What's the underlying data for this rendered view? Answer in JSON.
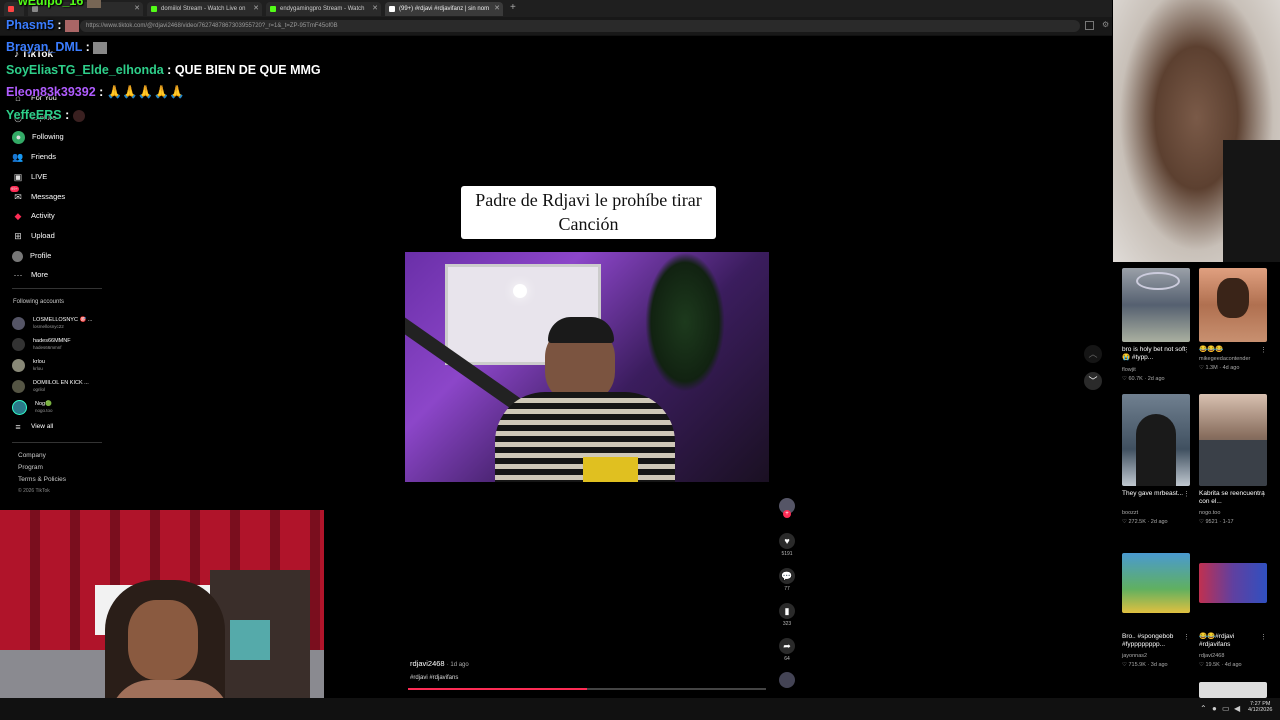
{
  "browser": {
    "tabs": [
      {
        "label": "",
        "color": "#ff4444"
      },
      {
        "label": "",
        "color": "#888888"
      },
      {
        "label": "domiilol Stream - Watch Live on",
        "color": "#53fc18"
      },
      {
        "label": "endygamingpro Stream - Watch",
        "color": "#53fc18"
      },
      {
        "label": "(99+) #rdjavi #rdjavifanz | sin nom",
        "color": "#ffffff"
      }
    ],
    "url": "https://www.tiktok.com/@rdjavi2468/video/7627487867303955720?_r=1&_t=ZP-95TmF45of0B"
  },
  "tiktok": {
    "logo": "TikTok",
    "nav": [
      {
        "label": "For You",
        "icon": "home-icon"
      },
      {
        "label": "Explore",
        "icon": "compass-icon"
      },
      {
        "label": "Following",
        "icon": "following-icon"
      },
      {
        "label": "Friends",
        "icon": "friends-icon"
      },
      {
        "label": "LIVE",
        "icon": "live-icon"
      },
      {
        "label": "Messages",
        "icon": "messages-icon",
        "badge": "99+"
      },
      {
        "label": "Activity",
        "icon": "activity-icon"
      },
      {
        "label": "Upload",
        "icon": "upload-icon"
      },
      {
        "label": "Profile",
        "icon": "profile-icon"
      },
      {
        "label": "More",
        "icon": "more-icon"
      }
    ],
    "following_header": "Following accounts",
    "following": [
      {
        "name": "LOSMELLOSNYC 🎯 ...",
        "handle": "losmellosnyc22"
      },
      {
        "name": "hades66MMNF",
        "handle": "hades66mmnf"
      },
      {
        "name": "krlou",
        "handle": "krlou"
      },
      {
        "name": "DOMIILOL EN KICK ...",
        "handle": "ogrilol"
      },
      {
        "name": "Nog🟢",
        "handle": "nogo.too"
      }
    ],
    "view_all": "View all",
    "footer": [
      "Company",
      "Program",
      "Terms & Policies"
    ],
    "copyright": "© 2026 TikTok"
  },
  "chat": [
    {
      "user": "wEuIpo_16",
      "message": "",
      "color": "#53fc18"
    },
    {
      "user": "Phasm5",
      "message": "",
      "color": "#3b7dff"
    },
    {
      "user": "Brayan_DML",
      "message": "",
      "color": "#3b7dff"
    },
    {
      "user": "SoyEliasTG_Elde_elhonda",
      "message": "QUE BIEN DE QUE MMG",
      "color": "#2ecf8a"
    },
    {
      "user": "Eleon83k39392",
      "message": "🙏🙏🙏🙏🙏",
      "color": "#b05cff"
    },
    {
      "user": "YeffeERS",
      "message": "",
      "color": "#2ecf8a"
    }
  ],
  "video": {
    "caption": "Padre de Rdjavi le prohíbe tirar Canción",
    "author": "rdjavi2468",
    "age": "· 1d ago",
    "hashtags": "#rdjavi #rdjavifans",
    "progress": 0.5,
    "likes": "5191",
    "comments": "77",
    "saves": "323",
    "shares": "64"
  },
  "recommended": [
    {
      "title": "bro is holy bet not soft😭 #typp...",
      "author": "flowjit",
      "views": "60.7K",
      "age": "2d ago"
    },
    {
      "title": "😂😂😂",
      "author": "mikegeedacontender",
      "views": "1.3M",
      "age": "4d ago"
    },
    {
      "title": "They gave mrbeast...",
      "author": "boozzt",
      "views": "272.5K",
      "age": "2d ago"
    },
    {
      "title": "Kabrita se reencuentra con el...",
      "author": "nogo.too",
      "views": "9521",
      "age": "1-17"
    },
    {
      "title": "Bro.. #spongebob #fypppppppp...",
      "author": "jayonnas2",
      "views": "715.9K",
      "age": "3d ago"
    },
    {
      "title": "😂😂#rdjavi #rdjavifans",
      "author": "rdjavi2468",
      "views": "19.5K",
      "age": "4d ago"
    }
  ],
  "taskbar": {
    "time": "7:27 PM",
    "date": "4/12/2026"
  }
}
